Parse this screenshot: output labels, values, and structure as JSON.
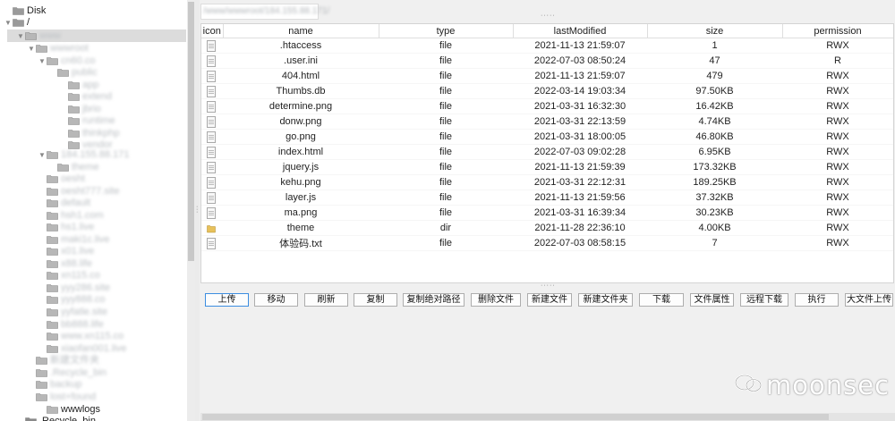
{
  "tree": {
    "root_label": "Disk",
    "slash_label": "/",
    "blurred_nodes": [
      "www",
      "wwwroot",
      "cn60.co",
      "public",
      "app",
      "extend",
      "jbrio",
      "runtime",
      "thinkphp",
      "vendor",
      "184.155.88.171",
      "theme",
      "oesht",
      "oesht777.site",
      "default",
      "hsh1.com",
      "hs1.live",
      "maki1c.live",
      "x01.live",
      "x88.life",
      "xn115.co",
      "yyy286.site",
      "yyy888.co",
      "yyfatle.site",
      "bb888.life",
      "www.xn115.co",
      "xiaofan001.live",
      "新建文件夹",
      ".Recycle_bin",
      "backup",
      "lost+found",
      "server"
    ],
    "wwwlogs_label": "wwwlogs",
    "recycle_label": ".Recycle_bin"
  },
  "path_value": "/www/wwwroot/184.155.88.171/",
  "table": {
    "headers": [
      "icon",
      "name",
      "type",
      "lastModified",
      "size",
      "permission"
    ],
    "rows": [
      {
        "icon": "file",
        "name": ".htaccess",
        "type": "file",
        "modified": "2021-11-13 21:59:07",
        "size": "1",
        "perm": "RWX"
      },
      {
        "icon": "file",
        "name": ".user.ini",
        "type": "file",
        "modified": "2022-07-03 08:50:24",
        "size": "47",
        "perm": "R"
      },
      {
        "icon": "file",
        "name": "404.html",
        "type": "file",
        "modified": "2021-11-13 21:59:07",
        "size": "479",
        "perm": "RWX"
      },
      {
        "icon": "file",
        "name": "Thumbs.db",
        "type": "file",
        "modified": "2022-03-14 19:03:34",
        "size": "97.50KB",
        "perm": "RWX"
      },
      {
        "icon": "file",
        "name": "determine.png",
        "type": "file",
        "modified": "2021-03-31 16:32:30",
        "size": "16.42KB",
        "perm": "RWX"
      },
      {
        "icon": "file",
        "name": "donw.png",
        "type": "file",
        "modified": "2021-03-31 22:13:59",
        "size": "4.74KB",
        "perm": "RWX"
      },
      {
        "icon": "file",
        "name": "go.png",
        "type": "file",
        "modified": "2021-03-31 18:00:05",
        "size": "46.80KB",
        "perm": "RWX"
      },
      {
        "icon": "file",
        "name": "index.html",
        "type": "file",
        "modified": "2022-07-03 09:02:28",
        "size": "6.95KB",
        "perm": "RWX"
      },
      {
        "icon": "file",
        "name": "jquery.js",
        "type": "file",
        "modified": "2021-11-13 21:59:39",
        "size": "173.32KB",
        "perm": "RWX"
      },
      {
        "icon": "file",
        "name": "kehu.png",
        "type": "file",
        "modified": "2021-03-31 22:12:31",
        "size": "189.25KB",
        "perm": "RWX"
      },
      {
        "icon": "file",
        "name": "layer.js",
        "type": "file",
        "modified": "2021-11-13 21:59:56",
        "size": "37.32KB",
        "perm": "RWX"
      },
      {
        "icon": "file",
        "name": "ma.png",
        "type": "file",
        "modified": "2021-03-31 16:39:34",
        "size": "30.23KB",
        "perm": "RWX"
      },
      {
        "icon": "folder",
        "name": "theme",
        "type": "dir",
        "modified": "2021-11-28 22:36:10",
        "size": "4.00KB",
        "perm": "RWX"
      },
      {
        "icon": "file",
        "name": "体验码.txt",
        "type": "file",
        "modified": "2022-07-03 08:58:15",
        "size": "7",
        "perm": "RWX"
      }
    ]
  },
  "buttons": [
    "上传",
    "移动",
    "刷新",
    "复制",
    "复制绝对路径",
    "删除文件",
    "新建文件",
    "新建文件夹",
    "下载",
    "文件属性",
    "远程下载",
    "执行",
    "大文件上传"
  ],
  "watermark": "moonsec",
  "colors": {
    "folder": "#e8c15a",
    "primary_border": "#3c8de0",
    "selection": "#dcdcdc"
  }
}
